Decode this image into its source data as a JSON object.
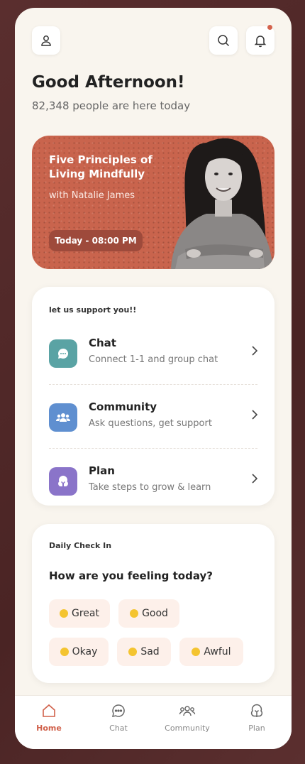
{
  "header": {
    "greeting": "Good Afternoon!",
    "subtext": "82,348 people are here today"
  },
  "hero": {
    "title": "Five Principles of Living Mindfully",
    "subtitle": "with Natalie James",
    "time_label": "Today - 08:00 PM"
  },
  "support": {
    "label": "let us support you!!",
    "items": [
      {
        "title": "Chat",
        "desc": "Connect 1-1 and group chat",
        "icon": "chat-icon",
        "color": "#5aa3a4"
      },
      {
        "title": "Community",
        "desc": "Ask questions, get support",
        "icon": "community-icon",
        "color": "#5f8fd0"
      },
      {
        "title": "Plan",
        "desc": "Take steps to grow & learn",
        "icon": "plan-icon",
        "color": "#8a74c9"
      }
    ]
  },
  "checkin": {
    "label": "Daily Check In",
    "question": "How are you feeling today?",
    "moods": [
      "Great",
      "Good",
      "Okay",
      "Sad",
      "Awful"
    ]
  },
  "tabs": [
    {
      "label": "Home",
      "icon": "home-icon",
      "active": true
    },
    {
      "label": "Chat",
      "icon": "chat-icon",
      "active": false
    },
    {
      "label": "Community",
      "icon": "community-icon",
      "active": false
    },
    {
      "label": "Plan",
      "icon": "plan-icon",
      "active": false
    }
  ],
  "colors": {
    "accent": "#d0604a",
    "hero_bg": "#c9644d",
    "page_bg": "#f9f5ee",
    "outer_bg": "#532a2a"
  }
}
